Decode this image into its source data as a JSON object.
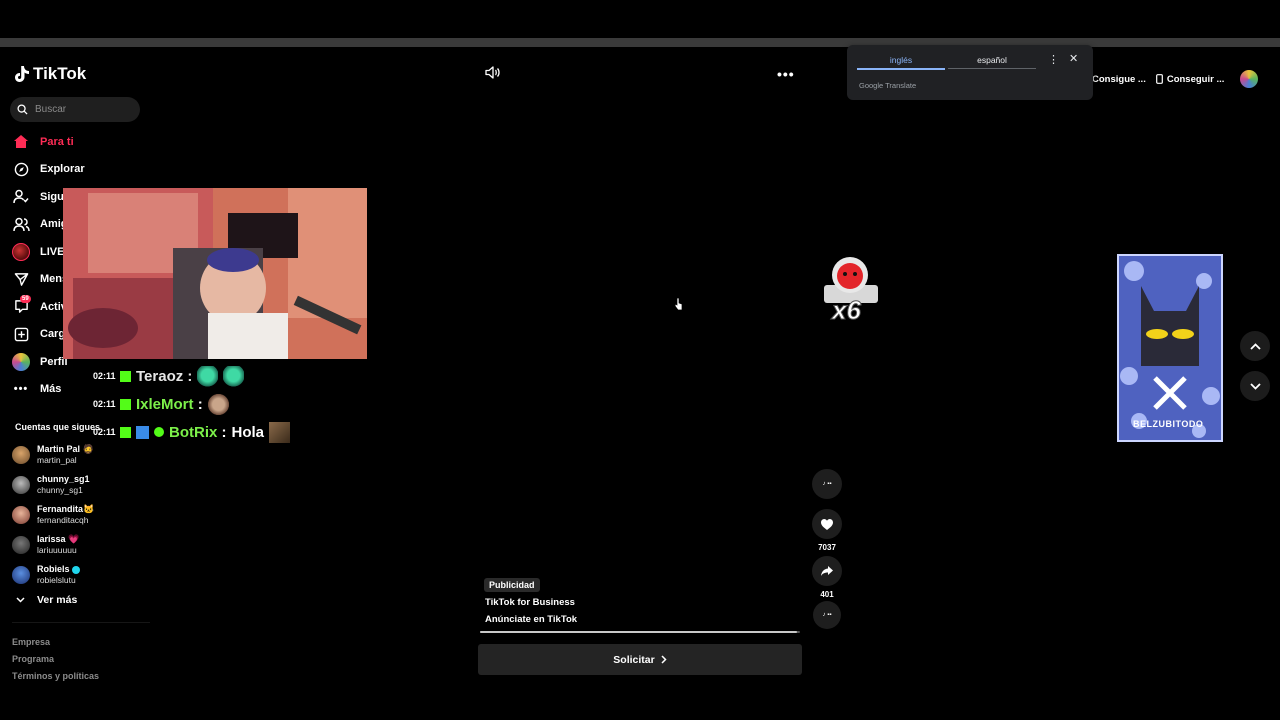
{
  "app": {
    "name": "TikTok"
  },
  "search": {
    "placeholder": "Buscar"
  },
  "nav": {
    "items": [
      {
        "label": "Para ti",
        "icon": "home-icon",
        "active": true
      },
      {
        "label": "Explorar",
        "icon": "compass-icon"
      },
      {
        "label": "Siguiendo",
        "icon": "following-icon"
      },
      {
        "label": "Amigos",
        "icon": "friends-icon"
      },
      {
        "label": "LIVE",
        "icon": "live-icon"
      },
      {
        "label": "Mensajes",
        "icon": "messages-icon"
      },
      {
        "label": "Actividad",
        "icon": "activity-icon",
        "badge": "59"
      },
      {
        "label": "Cargar",
        "icon": "upload-icon"
      },
      {
        "label": "Perfil",
        "icon": "profile-icon"
      },
      {
        "label": "Más",
        "icon": "more-icon"
      }
    ]
  },
  "following": {
    "title": "Cuentas que sigues",
    "accounts": [
      {
        "name": "Martin Pal 🧔",
        "handle": "martin_pal"
      },
      {
        "name": "chunny_sg1",
        "handle": "chunny_sg1"
      },
      {
        "name": "Fernandita🐱",
        "handle": "fernanditacqh"
      },
      {
        "name": "larissa 💗",
        "handle": "lariuuuuuu"
      },
      {
        "name": "Robiels",
        "handle": "robielslutu"
      }
    ],
    "see_more": "Ver más"
  },
  "footer": {
    "links": [
      "Empresa",
      "Programa",
      "Términos y políticas"
    ]
  },
  "stream_chat": [
    {
      "time": "02:11",
      "user": "Teraoz",
      "message": "",
      "user_color": "#e6e6e6"
    },
    {
      "time": "02:11",
      "user": "IxleMort",
      "message": "",
      "user_color": "#7cf04a"
    },
    {
      "time": "02:11",
      "user": "BotRix",
      "message": "Hola",
      "user_color": "#7cf04a"
    }
  ],
  "ad": {
    "badge": "Publicidad",
    "account": "TikTok for Business",
    "description": "Anúnciate en TikTok",
    "progress": 0.99,
    "cta_label": "Solicitar"
  },
  "actions": {
    "likes": "7037",
    "shares": "401"
  },
  "overlay": {
    "multiplier": "x6"
  },
  "thumbnail": {
    "caption": "BELZUBITODO"
  },
  "top_actions": {
    "coins": "Consigue ...",
    "app": "Conseguir ..."
  },
  "translate": {
    "source_lang": "inglés",
    "target_lang": "español",
    "brand": "Google Translate"
  },
  "colors": {
    "accent": "#fe2c55",
    "kick_green": "#53fc18"
  }
}
